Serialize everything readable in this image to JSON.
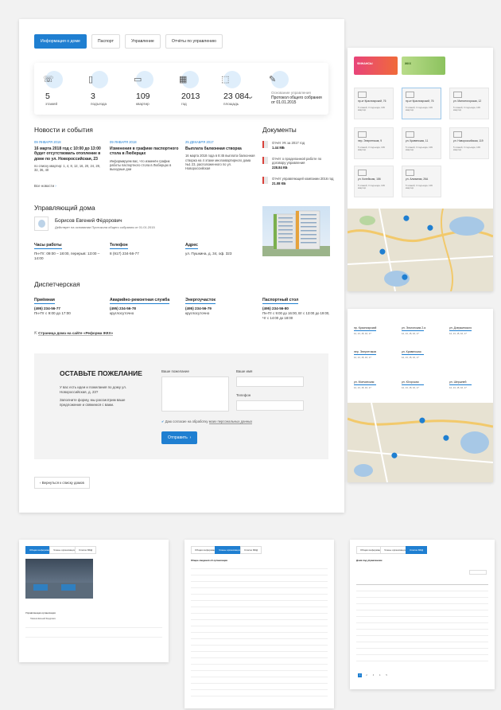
{
  "tabs": [
    {
      "label": "Информация о доме"
    },
    {
      "label": "Паспорт"
    },
    {
      "label": "Управление"
    },
    {
      "label": "Отчёты по управлению"
    }
  ],
  "stats": [
    {
      "icon": "stairs-icon",
      "value": "5",
      "label": "этажей"
    },
    {
      "icon": "door-icon",
      "value": "3",
      "label": "подъезда"
    },
    {
      "icon": "apartment-icon",
      "value": "109",
      "label": "квартир"
    },
    {
      "icon": "calendar-icon",
      "value": "2013",
      "label": "год"
    },
    {
      "icon": "area-icon",
      "value": "23 084",
      "unit": "м²",
      "label": "площадь"
    },
    {
      "icon": "document-check-icon",
      "note": "Основание управления",
      "value": "Протокол общего собрания от 01.01.2015"
    }
  ],
  "news": {
    "title": "Новости и события",
    "items": [
      {
        "date": "09 ЯНВАРЯ 2018",
        "title": "16 марта 2018 год с 10:00 до 13:00 будет отсутствовать отопление в доме по ул. Новороссийская, 23",
        "text": "по списку квартир: 1, 4, 8, 12, 16, 20, 24, 28, 32, 36, 40"
      },
      {
        "date": "09 ЯНВАРЯ 2018",
        "title": "Изменения в графике паспортного стола в Люберцах",
        "text": "Информируем вас, что изменён график работы паспортного стола в Люберцах в выходные дни"
      },
      {
        "date": "25 ДЕКАБРЯ 2017",
        "title": "Выплата балконная створка",
        "text": "16 марта 2018 года в 8:45 выплата балконная створка на 4 этаже многоквартирного дома №1 23, расположенного по ул. Новороссийская"
      }
    ],
    "all_link": "Все новости"
  },
  "documents": {
    "title": "Документы",
    "items": [
      {
        "title": "Отчёт УК за 2017 год",
        "size": "1.44 МБ"
      },
      {
        "title": "Отчёт о проделанной работе по договору управления",
        "size": "228.84 КБ"
      },
      {
        "title": "Отчёт управляющей компании 2016 год",
        "size": "21.08 КБ"
      }
    ]
  },
  "manager": {
    "title": "Управляющий дома",
    "name": "Борисов Евгений Фёдорович",
    "basis": "Действует на основании Протокола общего собрания от 01.01.2015",
    "hours_label": "Часы работы",
    "hours": "Пн-Пт: 09:00 – 18:00, перерыв: 13:00 – 14:00",
    "phone_label": "Телефон",
    "phone": "8 (917) 234-56-77",
    "address_label": "Адрес",
    "address": "ул. Пушкина, д. 34, оф. 323"
  },
  "dispatch": {
    "title": "Диспетчерская",
    "items": [
      {
        "label": "Приёмная",
        "phone": "(495) 234-56-77",
        "note": "Пн-Пт с 9:00 до 17:00"
      },
      {
        "label": "Аварийно-ремонтная служба",
        "phone": "(495) 234-56-78",
        "note": "круглосуточно"
      },
      {
        "label": "Энергоучасток",
        "phone": "(495) 234-56-79",
        "note": "круглосуточно"
      },
      {
        "label": "Паспортный стол",
        "phone": "(495) 234-56-80",
        "note": "Пн-Пт с 9:00 до 16:00, Вт с 13:00 до 19:00, Чт с 14:00 до 18:00"
      }
    ],
    "reform_link": "Страница дома на сайте «Реформа ЖКХ»"
  },
  "feedback": {
    "title": "ОСТАВЬТЕ ПОЖЕЛАНИЕ",
    "text1": "У вас есть идеи и пожелания по дому ул. Новороссийская, д. 23?",
    "text2": "Заполните форму, мы рассмотрим ваше предложение и свяжемся с вами.",
    "wish_label": "Ваше пожелание",
    "name_label": "Ваше имя",
    "phone_label": "Телефон",
    "consent_prefix": "Даю согласие на обработку ",
    "consent_link": "моих персональных данных",
    "submit": "Отправить"
  },
  "back_link": "Вернуться к списку домов",
  "right": {
    "banners": [
      {
        "text": "ФИНАНСЫ"
      },
      {
        "text": "ЖКХ"
      }
    ],
    "house_cards": [
      {
        "title": "пр-кт Красноярский, 76",
        "desc": "5 этажей, 3 подъезда, 109 квартир"
      },
      {
        "title": "пр-кт Красноярский, 76",
        "desc": "5 этажей, 3 подъезда, 109 квартир"
      },
      {
        "title": "ул. Магнитогорская, 12",
        "desc": "5 этажей, 3 подъезда, 109 квартир"
      },
      {
        "title": "пер. Энергетиков, 9",
        "desc": "5 этажей, 3 подъезда, 109 квартир"
      },
      {
        "title": "ул. Кривенская, 11",
        "desc": "5 этажей, 3 подъезда, 109 квартир"
      },
      {
        "title": "ул. Новороссийская, 119",
        "desc": "5 этажей, 3 подъезда, 109 квартир"
      },
      {
        "title": "ул. Копейская, 186",
        "desc": "5 этажей, 3 подъезда, 109 квартир"
      },
      {
        "title": "ул. Алмазная, 26А",
        "desc": "5 этажей, 3 подъезда, 109 квартир"
      }
    ],
    "streets": [
      {
        "name": "пр. Красноярский",
        "nums": "12, 13, 15, 16, 17"
      },
      {
        "name": "ул. Эльтонская 2-я",
        "nums": "12, 13, 15, 16, 17"
      },
      {
        "name": "ул. Дзержинского",
        "nums": "12, 13, 15, 16, 17"
      },
      {
        "name": "пер. Энергетиков",
        "nums": "12, 13, 15, 16, 17"
      },
      {
        "name": "ул. Кривенская",
        "nums": "12, 13, 15, 16, 17"
      },
      {
        "name": "ул. Мончинская",
        "nums": "12, 13, 15, 16, 17"
      },
      {
        "name": "ул. Югорская",
        "nums": "12, 13, 15, 16, 17"
      },
      {
        "name": "ул. Шершней",
        "nums": "12, 13, 15, 16, 17"
      }
    ]
  },
  "thumbs": {
    "t1_tabs": [
      "Общая информация",
      "Члены организации",
      "Список МКД"
    ],
    "t1_caption": "Управляющая организация",
    "t1_name": "Новиков Евгений Фёдорович",
    "t2_tabs": [
      "Общая информация",
      "Члены организации",
      "Список МКД"
    ],
    "t2_heading": "Общие сведения об организации",
    "t3_tabs": [
      "Общая информация",
      "Члены организации",
      "Список МКД"
    ],
    "t3_heading": "Дома под управлением",
    "t3_pages": [
      "1",
      "2",
      "3",
      "4",
      "5"
    ]
  }
}
